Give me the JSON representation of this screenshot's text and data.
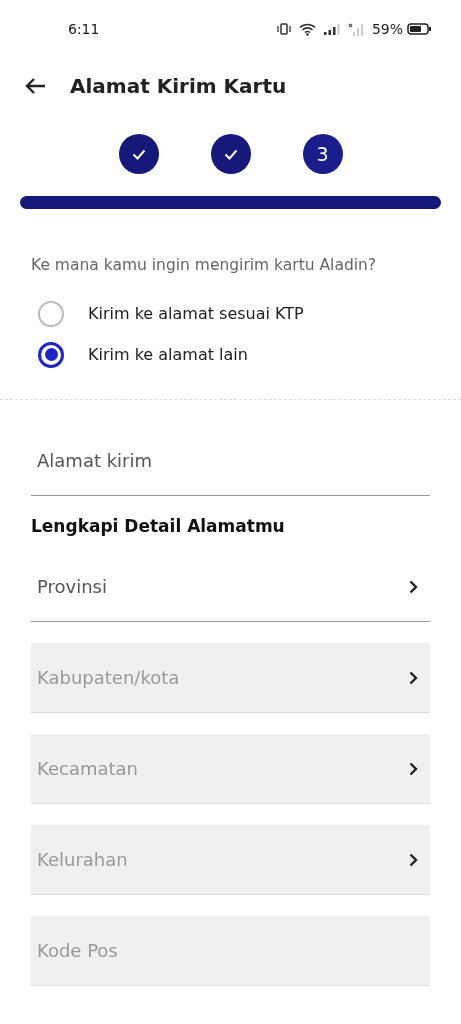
{
  "status_bar": {
    "time": "6:11",
    "battery": "59%"
  },
  "header": {
    "title": "Alamat Kirim Kartu"
  },
  "steps": [
    {
      "done": true
    },
    {
      "done": true
    },
    {
      "done": false,
      "label": "3"
    }
  ],
  "progress": {
    "level": 1
  },
  "question": "Ke mana kamu ingin mengirim kartu Aladin?",
  "options": [
    {
      "label": "Kirim ke alamat sesuai KTP",
      "selected": false
    },
    {
      "label": "Kirim ke alamat lain",
      "selected": true
    }
  ],
  "address_field": {
    "placeholder": "Alamat kirim",
    "disabled": false
  },
  "detail_heading": "Lengkapi Detail Alamatmu",
  "fields": [
    {
      "placeholder": "Provinsi",
      "kind": "select",
      "disabled": false
    },
    {
      "placeholder": "Kabupaten/kota",
      "kind": "select",
      "disabled": true
    },
    {
      "placeholder": "Kecamatan",
      "kind": "select",
      "disabled": true
    },
    {
      "placeholder": "Kelurahan",
      "kind": "select",
      "disabled": true
    },
    {
      "placeholder": "Kode Pos",
      "kind": "text",
      "disabled": true
    }
  ]
}
